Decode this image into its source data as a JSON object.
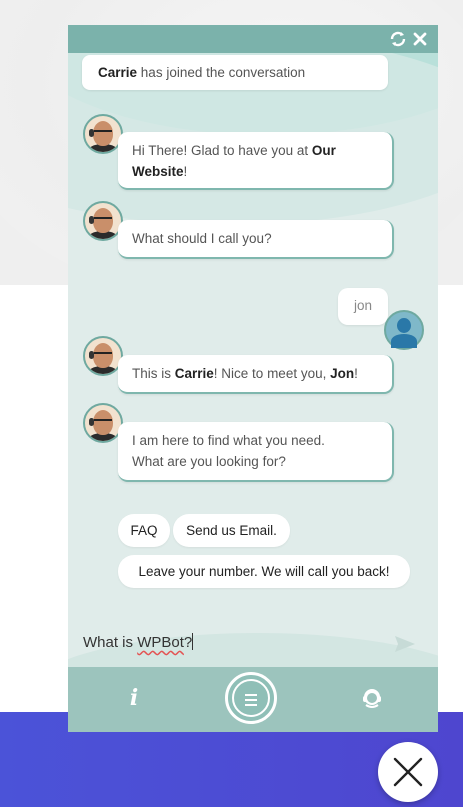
{
  "chat": {
    "header": {
      "refresh_icon": "refresh-icon",
      "close_icon": "close-icon"
    },
    "joined": {
      "agent_name": "Carrie",
      "suffix": "has joined the conversation"
    },
    "messages": [
      {
        "from": "bot",
        "parts": [
          "Hi There! Glad to have you at ",
          "Our Website",
          "!"
        ]
      },
      {
        "from": "bot",
        "text": "What should I call you?"
      },
      {
        "from": "user",
        "text": "jon"
      },
      {
        "from": "bot",
        "parts": [
          "This is ",
          "Carrie",
          "! Nice to meet you, ",
          "Jon",
          "!"
        ]
      },
      {
        "from": "bot",
        "line1": "I am here to find what you need.",
        "line2": "What are you looking for?"
      }
    ],
    "options": [
      "FAQ",
      "Send us Email.",
      "Leave your number. We will call you back!"
    ],
    "input": {
      "before": "What is ",
      "misspelled": "WPBot",
      "after": "?"
    },
    "footer": {
      "info_label": "i",
      "menu_icon": "menu-icon",
      "support_icon": "support-icon"
    }
  },
  "close_fab_icon": "close-icon",
  "colors": {
    "header": "#7bb2ab",
    "footer": "#9cc4bd",
    "chat_bg": "#e0ecea",
    "page_blue": "#4b53d8"
  }
}
